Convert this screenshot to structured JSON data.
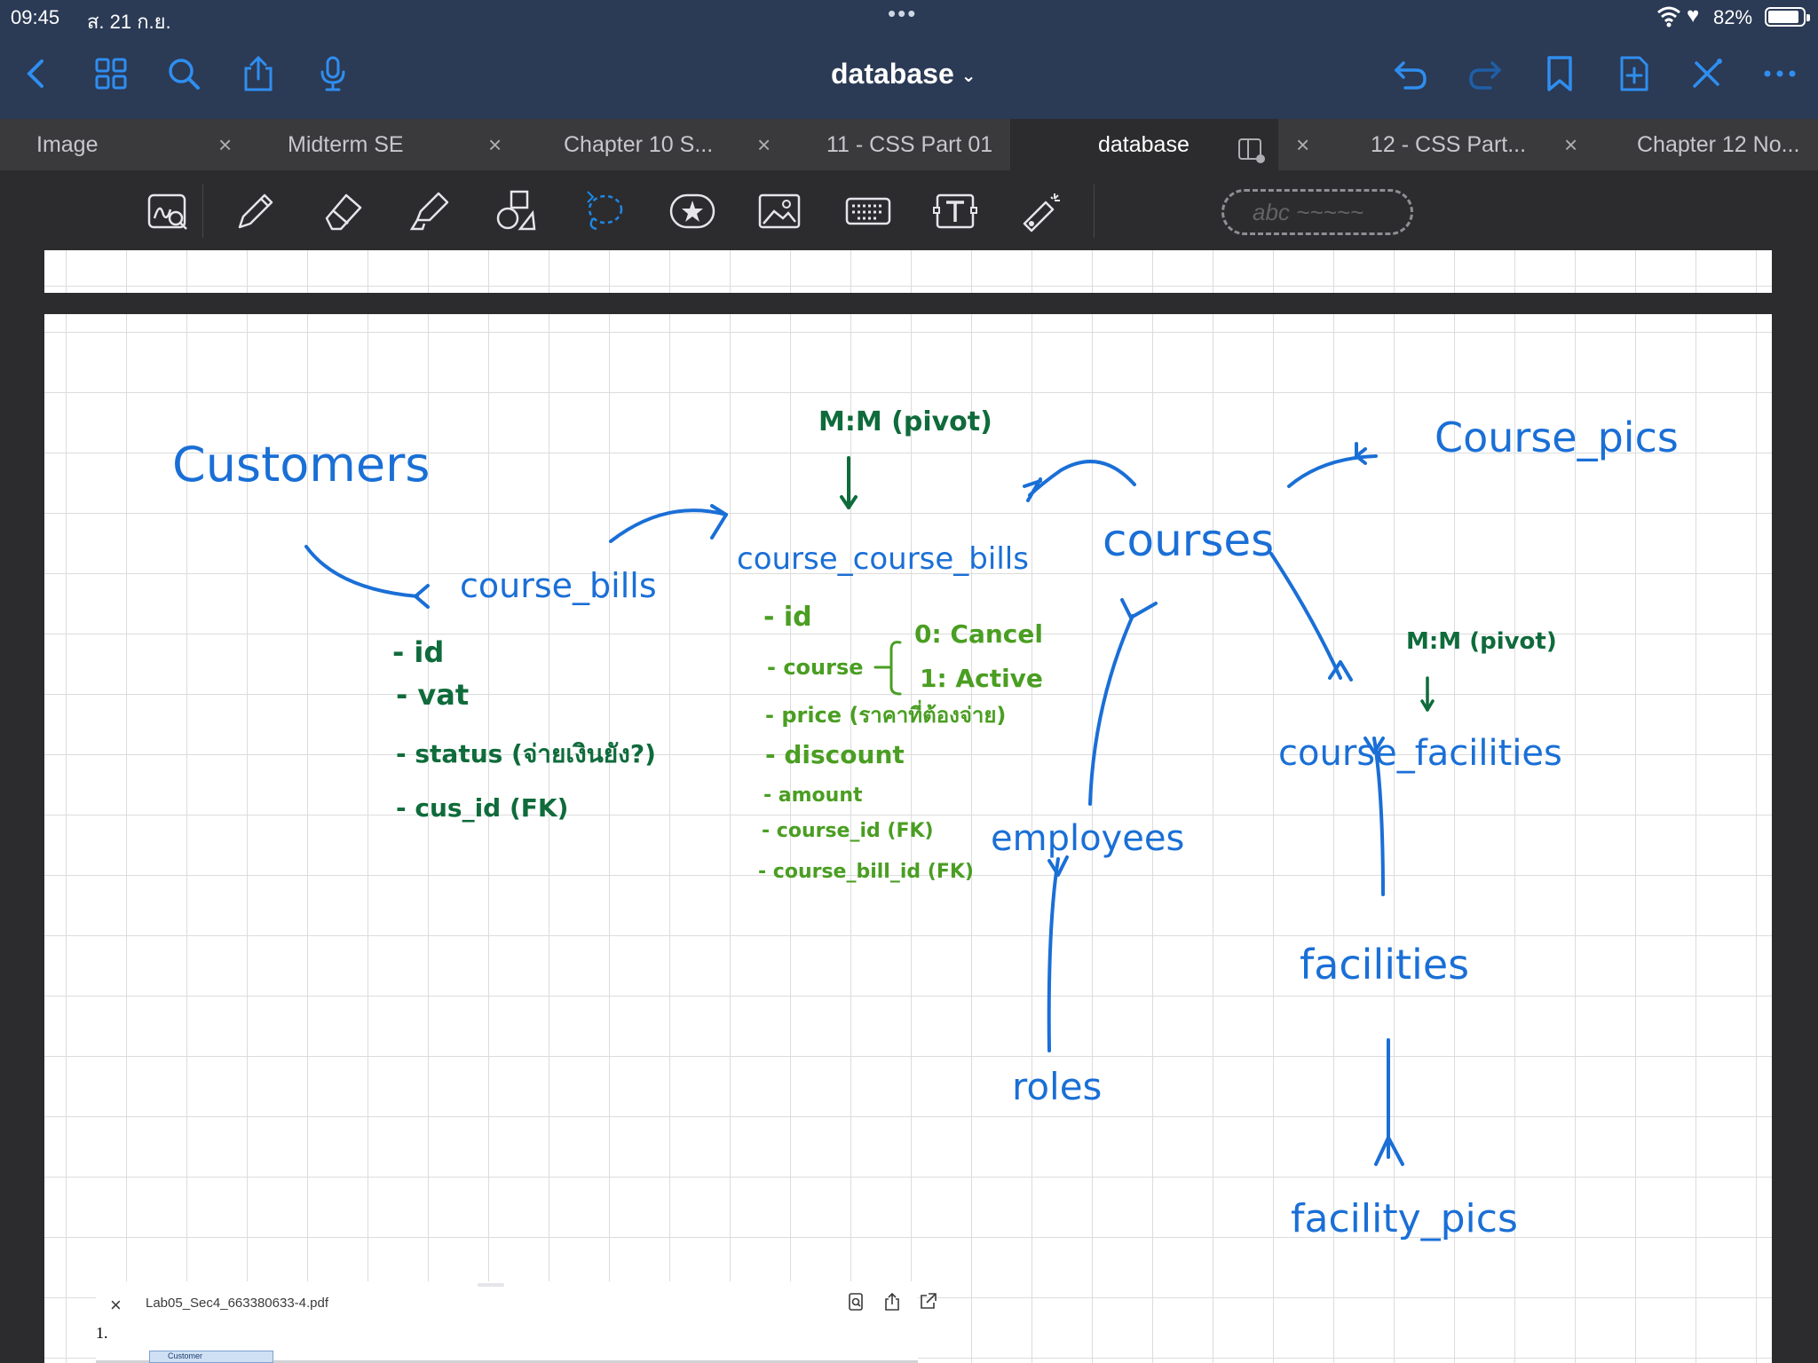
{
  "status": {
    "time": "09:45",
    "date": "ส. 21 ก.ย.",
    "battery_percent": "82%",
    "icons": [
      "wifi-icon",
      "heart-icon",
      "battery-icon"
    ]
  },
  "navbar": {
    "title": "database",
    "left_icons": [
      "back-icon",
      "grid-icon",
      "search-icon",
      "share-icon",
      "microphone-icon"
    ],
    "right_icons": [
      "undo-icon",
      "redo-icon",
      "bookmark-icon",
      "add-page-icon",
      "close-x-icon",
      "more-icon"
    ]
  },
  "tabs": [
    {
      "label": "Image"
    },
    {
      "label": "Midterm SE"
    },
    {
      "label": "Chapter 10  S..."
    },
    {
      "label": "11 - CSS Part 01"
    },
    {
      "label": "database"
    },
    {
      "label": "12 - CSS Part..."
    },
    {
      "label": "Chapter 12 No..."
    }
  ],
  "toolbar": {
    "tools": [
      "handwriting-zoom-icon",
      "pen-icon",
      "eraser-icon",
      "highlighter-icon",
      "shapes-icon",
      "lasso-icon",
      "elements-icon",
      "image-icon",
      "keyboard-icon",
      "text-box-icon",
      "laser-pointer-icon"
    ],
    "handwriting_placeholder": "abc ~~~~~"
  },
  "notes": {
    "customers": "Customers",
    "course_bills": "course_bills",
    "course_bills_fields": [
      "- id",
      "- vat",
      "- status (จ่ายเงินยัง?)",
      "- cus_id (FK)"
    ],
    "pivot_label_1": "M:M (pivot)",
    "course_course_bills": "course_course_bills",
    "ccb_fields": [
      "- id",
      "- course",
      "- price (ราคาที่ต้องจ่าย)",
      "- discount",
      "- amount",
      "- course_id (FK)",
      "- course_bill_id (FK)"
    ],
    "status_0": "0: Cancel",
    "status_1": "1: Active",
    "courses": "courses",
    "course_pics": "Course_pics",
    "employees": "employees",
    "roles": "roles",
    "pivot_label_2": "M:M (pivot)",
    "course_facilities": "course_facilities",
    "facilities": "facilities",
    "facility_pics": "facility_pics"
  },
  "pdf_panel": {
    "filename": "Lab05_Sec4_663380633-4.pdf",
    "page_number": "1.",
    "thumbnail_label": "Customer"
  },
  "colors": {
    "nav_bg": "#2b3a55",
    "ink_blue": "#1a6fd6",
    "ink_dark_green": "#0f6b3b",
    "ink_light_green": "#4a9e22",
    "accent_blue": "#1e88e5"
  }
}
